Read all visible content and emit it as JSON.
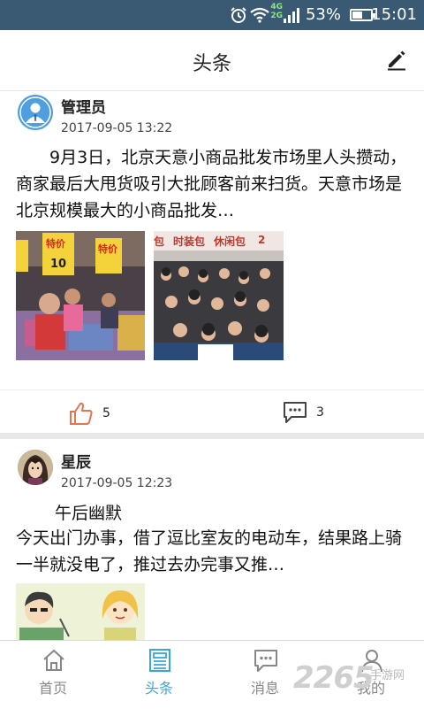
{
  "status_bar": {
    "time": "15:01",
    "battery": "53%",
    "battery_level": 0.53,
    "network": [
      "4G",
      "2G"
    ]
  },
  "header": {
    "title": "头条"
  },
  "posts": [
    {
      "author": "管理员",
      "time": "2017-09-05 13:22",
      "text": "9月3日，北京天意小商品批发市场里人头攒动，商家最后大甩货吸引大批顾客前来扫货。天意市场是北京规模最大的小商品批发…",
      "likes": "5",
      "comments": "3",
      "image_signs": [
        "特价",
        "10",
        "特价",
        "包",
        "时装包",
        "休闲包",
        "2"
      ]
    },
    {
      "author": "星辰",
      "time": "2017-09-05 12:23",
      "title": "午后幽默",
      "text": "今天出门办事，借了逗比室友的电动车，结果路上骑一半就没电了，推过去办完事又推…"
    }
  ],
  "tabs": [
    {
      "label": "首页",
      "icon": "home-icon"
    },
    {
      "label": "头条",
      "icon": "news-icon",
      "active": true
    },
    {
      "label": "消息",
      "icon": "message-icon"
    },
    {
      "label": "我的",
      "icon": "profile-icon"
    }
  ],
  "watermark": {
    "main": "2265",
    "sub": "手游网"
  },
  "colors": {
    "status_bar": "#3a5a73",
    "accent": "#38a6e3",
    "like_icon": "#e8734f",
    "divider": "#e8e8e8"
  }
}
